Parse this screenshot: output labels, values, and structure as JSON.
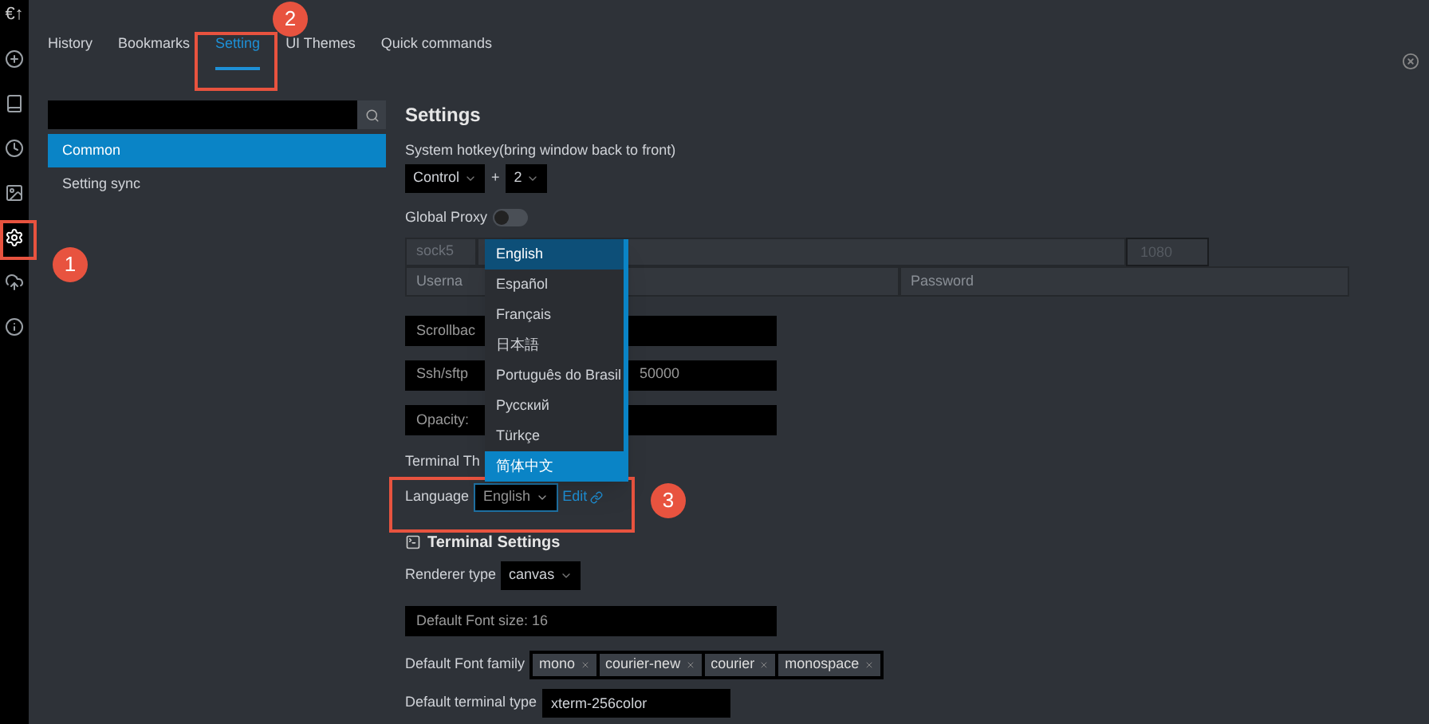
{
  "logo": "€↑",
  "sidebar_icons": [
    {
      "kind": "add",
      "selected": false
    },
    {
      "kind": "bookmarks",
      "selected": false
    },
    {
      "kind": "history",
      "selected": false
    },
    {
      "kind": "themes",
      "selected": false
    },
    {
      "kind": "settings",
      "selected": true
    },
    {
      "kind": "sync",
      "selected": false
    },
    {
      "kind": "info",
      "selected": false
    }
  ],
  "tabs": [
    {
      "label": "History",
      "selected": false
    },
    {
      "label": "Bookmarks",
      "selected": false
    },
    {
      "label": "Setting",
      "selected": true
    },
    {
      "label": "UI Themes",
      "selected": false
    },
    {
      "label": "Quick commands",
      "selected": false
    }
  ],
  "settings_menu": [
    {
      "label": "Common",
      "selected": true
    },
    {
      "label": "Setting sync",
      "selected": false
    }
  ],
  "settings": {
    "title": "Settings",
    "hotkey_label": "System hotkey(bring window back to front)",
    "hotkey_modifier": "Control",
    "hotkey_plus": "+",
    "hotkey_key": "2",
    "proxy_label": "Global Proxy",
    "proxy_on": false,
    "proxy_type": "sock5",
    "proxy_port_placeholder": "1080",
    "username_placeholder": "Userna",
    "password_placeholder": "Password",
    "scrollback": "Scrollbac",
    "ssh_timeout_label": "Ssh/sftp",
    "ssh_timeout_value": "50000",
    "opacity": "Opacity:",
    "terminal_theme_label": "Terminal Th",
    "language_label": "Language",
    "language_value": "English",
    "edit_link": "Edit"
  },
  "language_menu": [
    {
      "label": "English",
      "selected": true,
      "highlighted": false
    },
    {
      "label": "Español",
      "selected": false,
      "highlighted": false
    },
    {
      "label": "Français",
      "selected": false,
      "highlighted": false
    },
    {
      "label": "日本語",
      "selected": false,
      "highlighted": false
    },
    {
      "label": "Português do Brasil",
      "selected": false,
      "highlighted": false
    },
    {
      "label": "Русский",
      "selected": false,
      "highlighted": false
    },
    {
      "label": "Türkçe",
      "selected": false,
      "highlighted": false
    },
    {
      "label": "简体中文",
      "selected": false,
      "highlighted": true
    }
  ],
  "terminal": {
    "title": "Terminal Settings",
    "renderer_label": "Renderer type",
    "renderer_value": "canvas",
    "font_size": "Default Font size: 16",
    "font_family_label": "Default Font family",
    "font_families": [
      "mono",
      "courier-new",
      "courier",
      "monospace"
    ],
    "terminal_type_label": "Default terminal type",
    "terminal_type_value": "xterm-256color"
  },
  "annotations": [
    "1",
    "2",
    "3"
  ]
}
